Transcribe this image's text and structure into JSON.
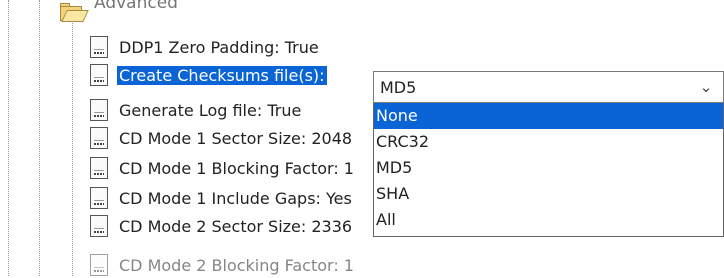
{
  "tree": {
    "folder_label": "Advanced",
    "items": [
      {
        "label": "DDP1 Zero Padding: True"
      },
      {
        "label": "Create Checksums file(s):"
      },
      {
        "label": "Generate Log file: True"
      },
      {
        "label": "CD Mode 1 Sector Size: 2048"
      },
      {
        "label": "CD Mode 1 Blocking Factor: 1"
      },
      {
        "label": "CD Mode 1 Include Gaps: Yes"
      },
      {
        "label": "CD Mode 2 Sector Size: 2336"
      },
      {
        "label": "CD Mode 2 Blocking Factor: 1"
      }
    ]
  },
  "combo": {
    "selected_value": "MD5",
    "options": [
      "None",
      "CRC32",
      "MD5",
      "SHA",
      "All"
    ],
    "highlighted_option": "None"
  },
  "colors": {
    "selection_blue": "#0a64d6"
  }
}
